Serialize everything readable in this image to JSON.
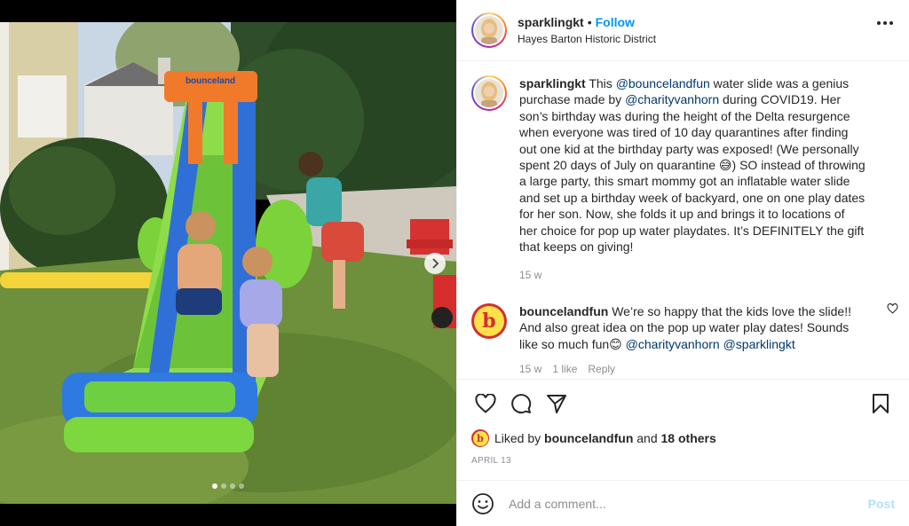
{
  "post": {
    "username": "sparklingkt",
    "separator": "•",
    "follow_label": "Follow",
    "location": "Hayes Barton Historic District"
  },
  "caption": {
    "username": "sparklingkt",
    "t1": "This ",
    "m1": "@bouncelandfun",
    "t2": " water slide was a genius purchase made by ",
    "m2": "@charityvanhorn",
    "t3": " during COVID19. Her son’s birthday was during the height of the Delta resurgence when everyone was tired of 10 day quarantines after finding out one kid at the birthday party was exposed! (We personally spent 20 days of July on quarantine 😅) SO instead of throwing a large party, this smart mommy got an inflatable water slide and set up a birthday week of backyard, one on one play dates for her son. Now, she folds it up and brings it to locations of her choice for pop up water playdates. It’s DEFINITELY the gift that keeps on giving!",
    "time": "15 w"
  },
  "comment": {
    "avatar_letter": "b",
    "username": "bouncelandfun",
    "t1": " We’re so happy that the kids love the slide!! And also great idea on the pop up water play dates! Sounds like so much fun😊 ",
    "m1": "@charityvanhorn",
    "m2": "@sparklingkt",
    "time": "15 w",
    "likes": "1 like",
    "reply": "Reply"
  },
  "likes": {
    "avatar_letter": "b",
    "prefix": "Liked by ",
    "user": "bouncelandfun",
    "middle": " and ",
    "others": "18 others"
  },
  "date": "APRIL 13",
  "add_comment": {
    "placeholder": "Add a comment...",
    "post_label": "Post"
  },
  "photo": {
    "slide_logo_text": "bounceland",
    "carousel_index": 1,
    "carousel_count": 4
  },
  "icons": {
    "more": "more-options-icon",
    "next": "chevron-right-icon",
    "like": "heart-icon",
    "comment": "comment-bubble-icon",
    "share": "paper-plane-icon",
    "save": "bookmark-icon",
    "emoji": "emoji-smile-icon"
  },
  "colors": {
    "link_blue": "#0095f6",
    "mention": "#00376b",
    "post_disabled": "#b2dffc",
    "secondary_text": "#8e8e8e"
  }
}
